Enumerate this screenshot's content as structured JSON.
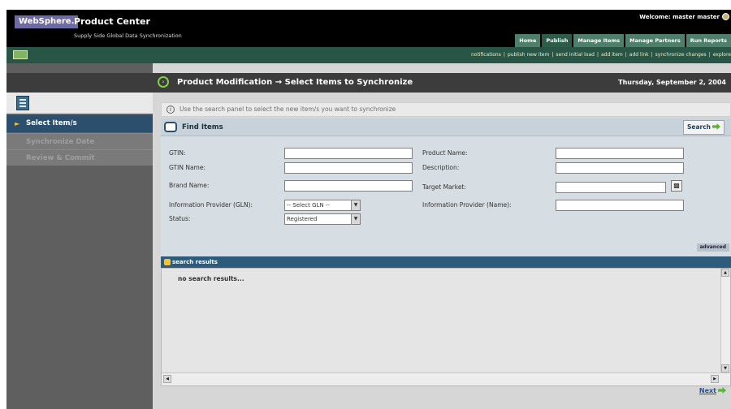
{
  "header": {
    "brand": "WebSphere.",
    "product_name": "Product Center",
    "product_subtitle": "Supply Side Global Data Synchronization",
    "welcome": "Welcome: master master",
    "tabs": [
      {
        "label": "Home"
      },
      {
        "label": "Publish"
      },
      {
        "label": "Manage Items"
      },
      {
        "label": "Manage Partners"
      },
      {
        "label": "Run Reports"
      }
    ]
  },
  "subnav": {
    "links": [
      "notifications",
      "publish new item",
      "send initial load",
      "add item",
      "add link",
      "synchronize changes",
      "explore"
    ]
  },
  "sidebar": {
    "steps": [
      {
        "label": "Select Item/s"
      },
      {
        "label": "Synchronize Date"
      },
      {
        "label": "Review & Commit"
      }
    ]
  },
  "main": {
    "title": "Product Modification → Select Items to Synchronize",
    "date": "Thursday, September 2, 2004",
    "info": "Use the search panel to select the new item/s you want to synchronize",
    "find_title": "Find Items",
    "search_label": "Search",
    "advanced_label": "advanced",
    "results_title": "search results",
    "no_results": "no search results...",
    "next_label": "Next"
  },
  "form": {
    "gtin_label": "GTIN:",
    "gtin_name_label": "GTIN Name:",
    "brand_name_label": "Brand Name:",
    "info_provider_gln_label": "Information Provider (GLN):",
    "status_label": "Status:",
    "product_name_label": "Product Name:",
    "description_label": "Description:",
    "target_market_label": "Target Market:",
    "info_provider_name_label": "Information Provider (Name):",
    "gln_select_value": "-- Select GLN --",
    "status_select_value": "Registered"
  },
  "icons": {
    "title": "forward-circle-icon",
    "info": "info-icon",
    "find": "speech-bubble-icon",
    "results": "search-results-icon",
    "search_arrow": "green-arrow-icon",
    "picker": "picker-icon"
  }
}
